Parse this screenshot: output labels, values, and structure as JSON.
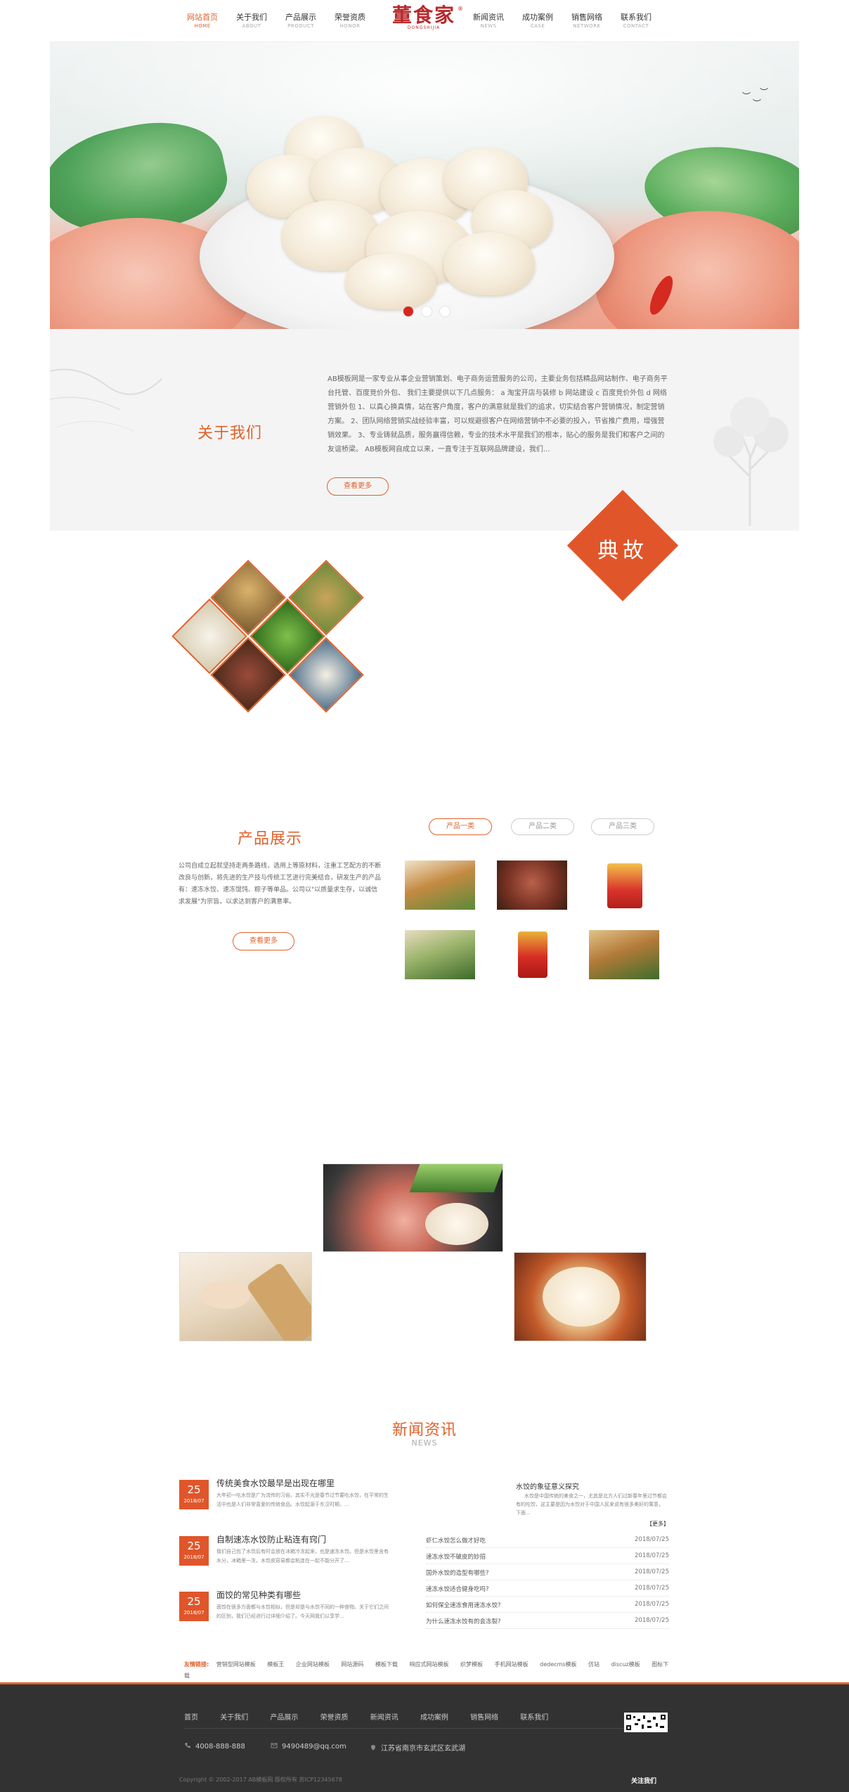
{
  "nav": {
    "items": [
      {
        "cn": "网站首页",
        "en": "HOME"
      },
      {
        "cn": "关于我们",
        "en": "ABOUT"
      },
      {
        "cn": "产品展示",
        "en": "PRODUCT"
      },
      {
        "cn": "荣誉资质",
        "en": "HONOR"
      },
      {
        "cn": "新闻资讯",
        "en": "NEWS"
      },
      {
        "cn": "成功案例",
        "en": "CASE"
      },
      {
        "cn": "销售网络",
        "en": "NETWORK"
      },
      {
        "cn": "联系我们",
        "en": "CONTACT"
      }
    ],
    "active_index": 0,
    "logo_text": "董食家",
    "logo_sub": "DONGSHIJIA",
    "logo_reg": "®"
  },
  "banner": {
    "slide_count": 3,
    "active_slide": 0
  },
  "about": {
    "title": "关于我们",
    "text": "AB模板网是一家专业从事企业营销策划、电子商务运营服务的公司，主要业务包括精品网站制作、电子商务平台托管、百度竞价外包、 我们主要提供以下几点服务： a 淘宝开店与装修 b 网站建设 c 百度竞价外包 d 网络营销外包 1、以真心换真情，站在客户角度，客户的满意就是我们的追求，切实结合客户营销情况，制定营销方案。 2、团队网络营销实战经验丰富，可以规避很客户在网络营销中不必要的投入，节省推广费用，增强营销效果。 3、专业铸就品质，服务赢得信赖，专业的技术水平是我们的根本，贴心的服务是我们和客户之间的友谊桥梁。 AB模板网自成立以来，一直专注于互联网品牌建设，我们...",
    "more": "查看更多"
  },
  "diangu": {
    "label": "典故"
  },
  "products": {
    "title": "产品展示",
    "text": "公司自成立起就坚持走两条路线，选用上等原材料，注重工艺配方的不断改良与创新，将先进的生产技与传统工艺进行完美结合，研发生产的产品有：速冻水饺、速冻馄饨、粽子等单品。公司以\"以质量求生存，以诚信求发展\"为宗旨，以求达到客户的满意率。",
    "more": "查看更多",
    "tabs": [
      "产品一类",
      "产品二类",
      "产品三类"
    ],
    "active_tab": 0
  },
  "news": {
    "title": "新闻资讯",
    "subtitle": "NEWS",
    "items": [
      {
        "day": "25",
        "ym": "2018/07",
        "title": "传统美食水饺最早是出现在哪里",
        "summary": "大年初一吃水饺是广为流传的习俗。其实不光是春节过节要吃水饺，在平常的生活中也是人们非常喜爱的传统食品。水饺起源于东汉时期，..."
      },
      {
        "day": "25",
        "ym": "2018/07",
        "title": "自制速冻水饺防止粘连有窍门",
        "summary": "我们自己包了水饺后有时会放在冰箱冷冻起来，也是速冻水饺。但是水饺里含有水分，冰箱里一冻，水饺皮容易都会粘连在一起不能分开了..."
      },
      {
        "day": "25",
        "ym": "2018/07",
        "title": "面饺的常见种类有哪些",
        "summary": "面饺在很多方面都与水饺相似，但是却是与水饺不同的一种食物。关于它们之间的区别，我们已经进行过详细介绍了。今天网我们以享学..."
      }
    ],
    "featured": {
      "title": "水饺的象征意义探究",
      "text": "水饺是中国传统的美食之一，尤其是北方人们过新春年里过节都会有的吃饺，这主要是因为水饺对于中国人民来说有很多美好的寓意，下面...",
      "more": "【更多】"
    },
    "list": [
      {
        "title": "虾仁水饺怎么做才好吃",
        "date": "2018/07/25"
      },
      {
        "title": "速冻水饺不破皮的妙招",
        "date": "2018/07/25"
      },
      {
        "title": "国外水饺的造型有哪些?",
        "date": "2018/07/25"
      },
      {
        "title": "速冻水饺适合健身吃吗?",
        "date": "2018/07/25"
      },
      {
        "title": "如何保全速冻食用速冻水饺?",
        "date": "2018/07/25"
      },
      {
        "title": "为什么速冻水饺有的会冻裂?",
        "date": "2018/07/25"
      }
    ]
  },
  "links": {
    "label": "友情链接:",
    "items": [
      "营销型网站模板",
      "模板王",
      "企业网站模板",
      "网站源码",
      "模板下载",
      "响应式网站模板",
      "织梦模板",
      "手机网站模板",
      "dedecms模板",
      "仿站",
      "discuz模板",
      "图标下载"
    ]
  },
  "footer": {
    "nav": [
      "首页",
      "关于我们",
      "产品展示",
      "荣誉资质",
      "新闻资讯",
      "成功案例",
      "销售网络",
      "联系我们"
    ],
    "phone": "4008-888-888",
    "email": "9490489@qq.com",
    "address": "江苏省南京市玄武区玄武湖",
    "copyright": "Copyright © 2002-2017 AB模板网 版权所有   苏ICP12345678",
    "follow": "关注我们"
  },
  "colors": {
    "accent": "#e0622b",
    "logo": "#b8292c",
    "footer_bg": "#333232"
  }
}
